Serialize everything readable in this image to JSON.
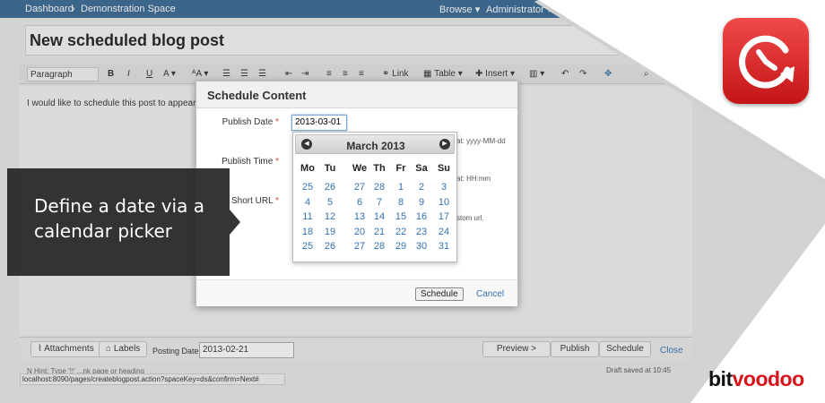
{
  "topnav": {
    "dashboard": "Dashboard",
    "sep": "›",
    "space": "Demonstration Space",
    "browse": "Browse ▾",
    "admin": "Administrator ▾"
  },
  "page_title": "New scheduled blog post",
  "toolbar": {
    "paragraph": "Paragraph",
    "link": "Link",
    "table": "Table",
    "insert": "Insert"
  },
  "editor": {
    "body_text": "I would like to schedule this post to appear o"
  },
  "bottom": {
    "attachments": "Attachments",
    "labels": "Labels",
    "posting_label": "Posting Date:",
    "posting_value": "2013-02-21",
    "preview": "Preview >",
    "publish": "Publish",
    "schedule": "Schedule",
    "close": "Close",
    "draft": "Draft saved at 10:45",
    "hint": "N Hint: Type '!!' ...nk page or heading"
  },
  "statusbar": "localhost:8090/pages/createblogpost.action?spaceKey=ds&confirm=Next#",
  "dialog": {
    "title": "Schedule Content",
    "publish_date_label": "Publish Date",
    "publish_date_value": "2013-03-01",
    "publish_time_label": "Publish Time",
    "short_url_label": "Short URL",
    "required_mark": "*",
    "date_format_hint": "at: yyyy-MM-dd",
    "time_format_hint": "at: HH:mm",
    "url_hint": "stom url.",
    "schedule_button": "Schedule",
    "cancel_link": "Cancel"
  },
  "calendar": {
    "month_label": "March 2013",
    "prev_glyph": "◀",
    "next_glyph": "▶",
    "weekdays": [
      "Mo",
      "Tu",
      "We",
      "Th",
      "Fr",
      "Sa",
      "Su"
    ],
    "weeks": [
      [
        "25",
        "26",
        "27",
        "28",
        "1",
        "2",
        "3"
      ],
      [
        "4",
        "5",
        "6",
        "7",
        "8",
        "9",
        "10"
      ],
      [
        "11",
        "12",
        "13",
        "14",
        "15",
        "16",
        "17"
      ],
      [
        "18",
        "19",
        "20",
        "21",
        "22",
        "23",
        "24"
      ],
      [
        "25",
        "26",
        "27",
        "28",
        "29",
        "30",
        "31"
      ]
    ]
  },
  "tooltip": {
    "text": "Define a date via a calendar picker"
  },
  "brand": {
    "part1": "bit",
    "part2": "voodoo",
    "accent_color": "#d8131b"
  }
}
